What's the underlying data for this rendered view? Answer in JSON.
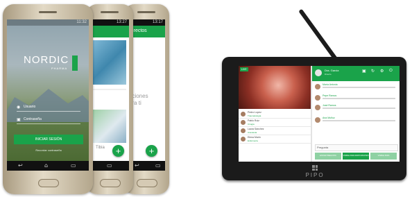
{
  "phone_front": {
    "status_text": "11:32",
    "logo_word": "NORDIC",
    "logo_tagline": "PHARMA",
    "user_label": "Usuario",
    "password_label": "Contraseña",
    "login_button": "INICIAR SESIÓN",
    "forgot_link": "Recordar contraseña"
  },
  "phone_middle": {
    "status_text": "13:27",
    "bottom_label": "Tibia"
  },
  "phone_back": {
    "status_text": "13:17",
    "header_title": "Directos",
    "body_line1": "nciones",
    "body_line2": "ara ti"
  },
  "phone_fab_symbol": "+",
  "phone_nav_icons": {
    "back": "↩",
    "home": "⌂",
    "recent": "▭"
  },
  "tablet": {
    "live_badge": "LIVE",
    "brand": "PIPO",
    "header_user": "Dra. Garcia",
    "header_sub": "Directo",
    "participants": [
      {
        "name": "Pedro Lopez",
        "sub": "Traumatología"
      },
      {
        "name": "Pablo Ruiz",
        "sub": "Cirugía"
      },
      {
        "name": "Laura Sánchez",
        "sub": "Anestesia"
      },
      {
        "name": "Elena Marin",
        "sub": "Enfermería"
      }
    ],
    "comments": [
      {
        "name": "María Antonia"
      },
      {
        "name": "Pepe Ramos"
      },
      {
        "name": "José Ramos"
      },
      {
        "name": "Ana Muñoz"
      }
    ],
    "question_placeholder": "Pregunta",
    "buttons": [
      "ENVIAR PREGUNTA",
      "VISIBLE PARA PARTICIPANTES",
      "VISIBLE PARA ORGANIZADORES"
    ]
  },
  "colors": {
    "brand_green": "#1aa34a"
  }
}
